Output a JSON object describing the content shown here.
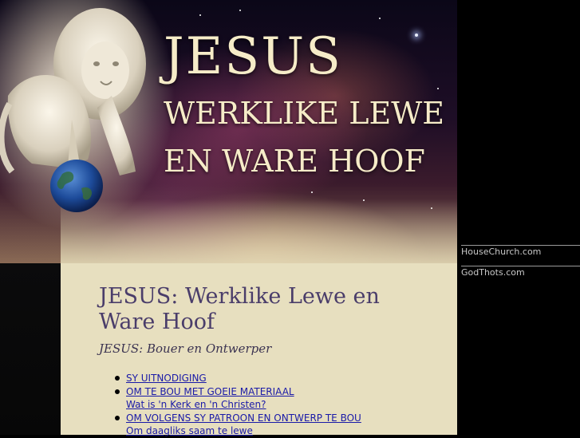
{
  "banner": {
    "title_line1": "JESUS",
    "title_line2": "WERKLIKE LEWE",
    "title_line3": "EN WARE HOOF"
  },
  "main": {
    "heading": "JESUS: Werklike Lewe en Ware Hoof",
    "subheading": "JESUS: Bouer en Ontwerper",
    "links": [
      "SY UITNODIGING",
      "OM TE BOU MET GOEIE MATERIAAL",
      "Wat is 'n Kerk en 'n Christen?",
      "OM VOLGENS SY PATROON EN ONTWERP TE BOU",
      "Om daagliks saam te lewe"
    ]
  },
  "sidebar": {
    "links": [
      "HouseChurch.com",
      "GodThots.com"
    ]
  },
  "colors": {
    "content_bg": "#e7dfbf",
    "heading": "#4a3d6a",
    "link": "#1a1aa8",
    "title_text": "#f6ecc8"
  },
  "icons": [
    "lion-statue",
    "globe"
  ]
}
